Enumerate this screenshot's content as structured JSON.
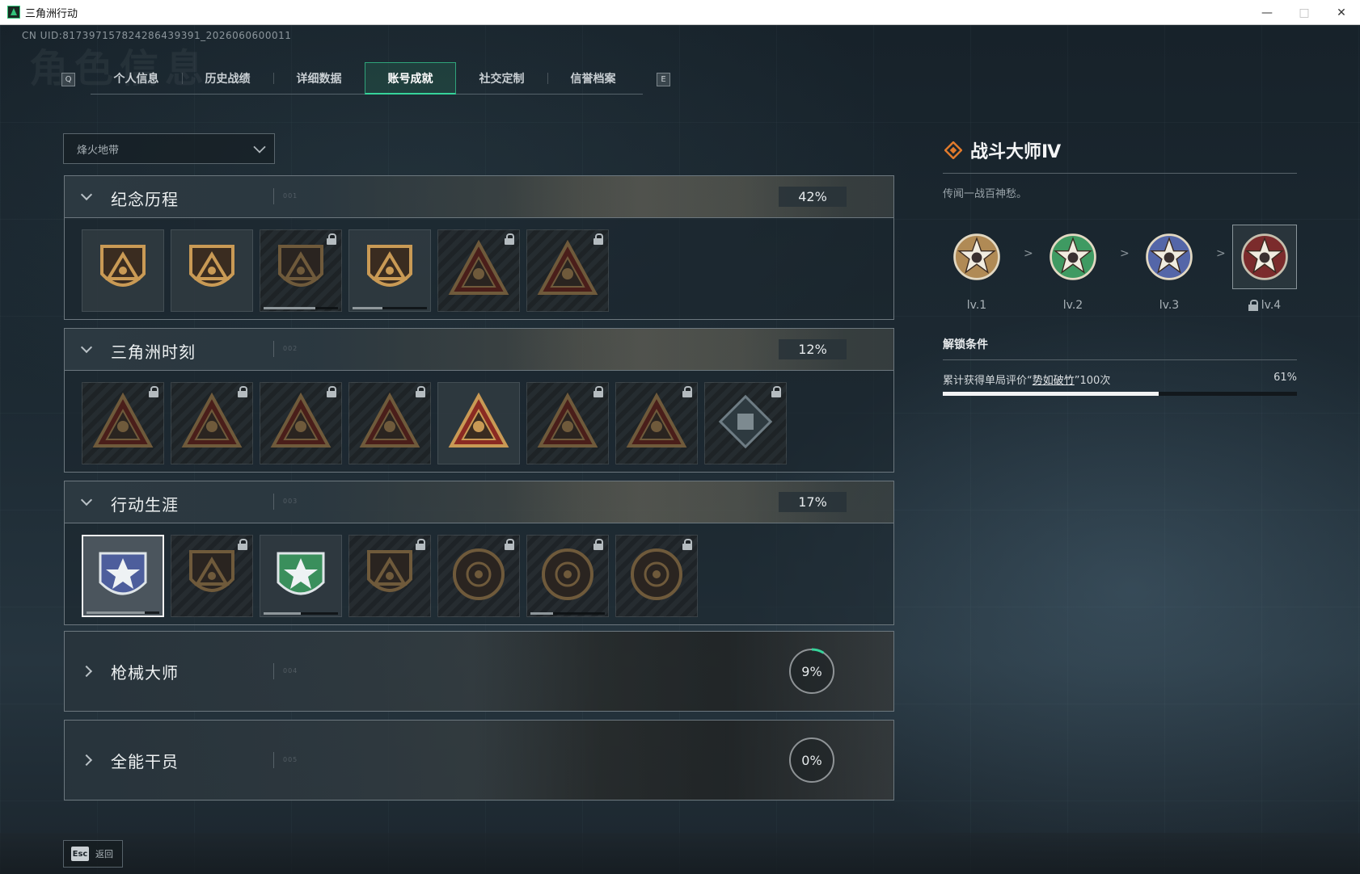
{
  "window": {
    "title": "三角洲行动",
    "minimize_icon": "minimize-icon",
    "maximize_icon": "maximize-icon",
    "close_icon": "close-icon"
  },
  "uid": "CN UID:817397157824286439391_2026060600011",
  "watermark": "角色信息",
  "tabs": {
    "left_key": "Q",
    "right_key": "E",
    "items": [
      {
        "label": "个人信息"
      },
      {
        "label": "历史战绩"
      },
      {
        "label": "详细数据"
      },
      {
        "label": "账号成就",
        "active": true
      },
      {
        "label": "社交定制"
      },
      {
        "label": "信誉档案"
      }
    ]
  },
  "mode_select": {
    "value": "烽火地带"
  },
  "categories": [
    {
      "title": "纪念历程",
      "number": "001",
      "progress": "42%",
      "expanded": true,
      "badges": [
        {
          "icon": "delta-shield-icon",
          "locked": false,
          "progress": 0
        },
        {
          "icon": "helicopter-badge-icon",
          "locked": false,
          "progress": 0
        },
        {
          "icon": "hex-shield-icon",
          "locked": true,
          "progress": 0.7
        },
        {
          "icon": "eagle-crest-icon",
          "locked": false,
          "progress": 0.4
        },
        {
          "icon": "hooded-triangle-icon",
          "locked": true,
          "progress": 0
        },
        {
          "icon": "skull-triangle-icon",
          "locked": true,
          "progress": 0
        }
      ]
    },
    {
      "title": "三角洲时刻",
      "number": "002",
      "progress": "12%",
      "expanded": true,
      "badges": [
        {
          "icon": "crate-triangle-icon",
          "locked": true
        },
        {
          "icon": "soldier-triangle-icon",
          "locked": true
        },
        {
          "icon": "kneeling-triangle-icon",
          "locked": true
        },
        {
          "icon": "dice-triangle-icon",
          "locked": true
        },
        {
          "icon": "runner-triangle-icon",
          "locked": false
        },
        {
          "icon": "squad-triangle-icon",
          "locked": true
        },
        {
          "icon": "koi-triangle-icon",
          "locked": true
        },
        {
          "icon": "cube-diamond-icon",
          "locked": true
        }
      ]
    },
    {
      "title": "行动生涯",
      "number": "003",
      "progress": "17%",
      "expanded": true,
      "badges": [
        {
          "icon": "star-medal-icon",
          "locked": false,
          "selected": true,
          "progress": 0.8
        },
        {
          "icon": "eagle-shield-icon",
          "locked": true
        },
        {
          "icon": "green-star-shield-icon",
          "locked": false,
          "progress": 0.5
        },
        {
          "icon": "hex-dice-shield-icon",
          "locked": true
        },
        {
          "icon": "fist-circle-icon",
          "locked": true
        },
        {
          "icon": "skull-circle-icon",
          "locked": true,
          "progress": 0.3
        },
        {
          "icon": "eye-circle-icon",
          "locked": true
        }
      ]
    },
    {
      "title": "枪械大师",
      "number": "004",
      "progress": "9%",
      "progress_value": 0.09,
      "expanded": false
    },
    {
      "title": "全能干员",
      "number": "005",
      "progress": "0%",
      "progress_value": 0,
      "expanded": false
    }
  ],
  "detail": {
    "title": "战斗大师Ⅳ",
    "title_icon": "orange-diamond-icon",
    "description": "传闻一战百神愁。",
    "levels": [
      {
        "label": "lv.1",
        "icon": "bronze-star-medal-icon",
        "locked": false
      },
      {
        "label": "lv.2",
        "icon": "green-star-medal-icon",
        "locked": false
      },
      {
        "label": "lv.3",
        "icon": "blue-star-medal-icon",
        "locked": false
      },
      {
        "label": "lv.4",
        "icon": "red-star-medal-icon",
        "locked": true,
        "current": true
      }
    ],
    "arrow": ">",
    "unlock_title": "解锁条件",
    "unlock_prefix": "累计获得单局评价“",
    "unlock_highlight": "势如破竹",
    "unlock_suffix": "”100次",
    "unlock_progress": "61%",
    "unlock_progress_value": 0.61
  },
  "bottom": {
    "esc_key": "Esc",
    "esc_label": "返回"
  },
  "colors": {
    "accent_green": "#36d39a",
    "accent_orange": "#e07a2c",
    "panel_border": "#6c777e"
  }
}
